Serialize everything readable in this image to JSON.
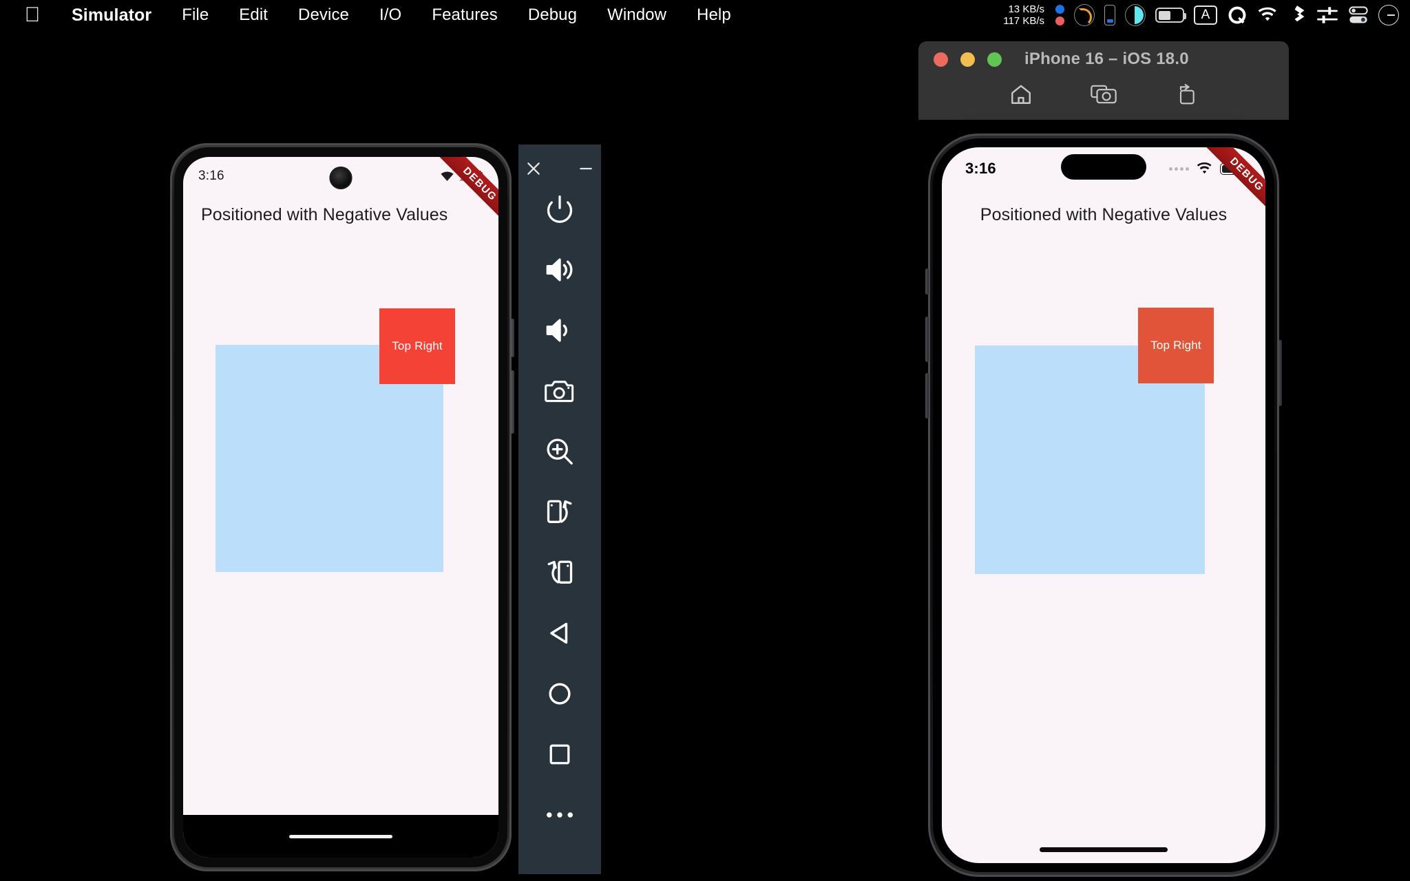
{
  "menubar": {
    "apple_icon": "apple-logo",
    "items": [
      {
        "label": "Simulator",
        "bold": true
      },
      {
        "label": "File"
      },
      {
        "label": "Edit"
      },
      {
        "label": "Device"
      },
      {
        "label": "I/O"
      },
      {
        "label": "Features"
      },
      {
        "label": "Debug"
      },
      {
        "label": "Window"
      },
      {
        "label": "Help"
      }
    ],
    "status": {
      "net_up": "13 KB/s",
      "net_down": "117 KB/s",
      "icons": [
        "battery-ring-icon",
        "phone-battery-icon",
        "display-brightness-icon",
        "battery-icon",
        "input-source-a-icon",
        "quicktime-icon",
        "wifi-icon",
        "dropbox-icon",
        "audio-mixer-icon",
        "control-center-icon",
        "siri-icon"
      ]
    }
  },
  "simulator_window": {
    "title": "iPhone 16 – iOS 18.0",
    "traffic_lights": [
      {
        "name": "close-button",
        "color": "#ec6a5e"
      },
      {
        "name": "minimize-button",
        "color": "#f4bd4f"
      },
      {
        "name": "zoom-button",
        "color": "#61c554"
      }
    ],
    "toolbar": [
      {
        "name": "home-button",
        "icon": "home-icon"
      },
      {
        "name": "screenshot-button",
        "icon": "camera-icon"
      },
      {
        "name": "rotate-button",
        "icon": "rotate-icon"
      }
    ]
  },
  "android_device": {
    "status_bar": {
      "time": "3:16",
      "icons": [
        "wifi-icon",
        "cellular-signal-icon",
        "battery-icon"
      ]
    },
    "app": {
      "title": "Positioned with Negative Values",
      "blue_box_color": "#BBDEFB",
      "red_box_color": "#F44336",
      "red_box_label": "Top Right",
      "background_color": "#FAF4F8"
    },
    "debug_ribbon": "DEBUG",
    "nav_bar": {
      "gesture_bar": true
    }
  },
  "emulator_toolbar": {
    "window_buttons": [
      {
        "name": "close-emulator-button",
        "glyph": "✕"
      },
      {
        "name": "minimize-emulator-button",
        "glyph": "−"
      }
    ],
    "buttons": [
      {
        "name": "power-button",
        "icon": "power-icon"
      },
      {
        "name": "volume-up-button",
        "icon": "volume-up-icon"
      },
      {
        "name": "volume-down-button",
        "icon": "volume-down-icon"
      },
      {
        "name": "screenshot-button",
        "icon": "camera-icon"
      },
      {
        "name": "zoom-button",
        "icon": "zoom-in-icon"
      },
      {
        "name": "rotate-left-button",
        "icon": "rotate-left-icon"
      },
      {
        "name": "rotate-right-button",
        "icon": "rotate-right-icon"
      },
      {
        "name": "back-button",
        "icon": "back-triangle-icon"
      },
      {
        "name": "home-button",
        "icon": "home-circle-icon"
      },
      {
        "name": "overview-button",
        "icon": "recents-square-icon"
      },
      {
        "name": "more-button",
        "icon": "more-horizontal-icon"
      }
    ]
  },
  "ios_device": {
    "status_bar": {
      "time": "3:16",
      "icons": [
        "signal-dots-icon",
        "wifi-icon",
        "battery-icon"
      ]
    },
    "app": {
      "title": "Positioned with Negative Values",
      "blue_box_color": "#BBDEFB",
      "red_box_color": "#E2543A",
      "red_box_label": "Top Right",
      "background_color": "#FAF4F8"
    },
    "debug_ribbon": "DEBUG",
    "home_indicator": true
  }
}
